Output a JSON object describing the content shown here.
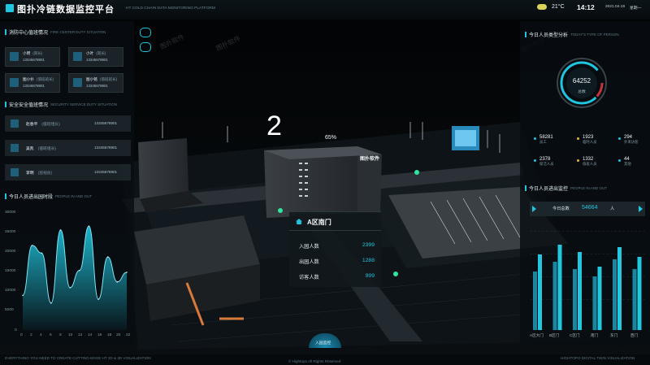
{
  "header": {
    "title": "图扑冷链数据监控平台",
    "subtitle": "HT COLD CHAIN DATA MONITORING PLATFORM",
    "temperature": "21°C",
    "time": "14:12",
    "date": "2021.04.19",
    "weekday": "星期一"
  },
  "left": {
    "duty": {
      "title": "消防中心值班情况",
      "title_en": "FIRE CENTER DUTY SITUATION",
      "people": [
        {
          "name": "小明",
          "role": "(岗长)",
          "phone": "13345678901"
        },
        {
          "name": "小叶",
          "role": "(岗长)",
          "phone": "13345678901"
        },
        {
          "name": "图小扑",
          "role": "(值班班长)",
          "phone": "13345678901"
        },
        {
          "name": "图小铭",
          "role": "(值班班长)",
          "phone": "13345678901"
        }
      ]
    },
    "security": {
      "title": "安全安全值班情况",
      "title_en": "SECURITY SERVICE DUTY SITUATION",
      "people": [
        {
          "name": "赵春平",
          "role": "(值班组长)",
          "phone": "13345678901"
        },
        {
          "name": "吴凯",
          "role": "(值班组长)",
          "phone": "13345678901"
        },
        {
          "name": "李明",
          "role": "(巡视员)",
          "phone": "13345678901"
        }
      ]
    },
    "flow": {
      "title": "今日人员进出园时段",
      "title_en": "PEOPLE IN AND OUT"
    }
  },
  "chart_data": [
    {
      "type": "area",
      "title": "今日人员进出园时段",
      "x": [
        0,
        2,
        4,
        6,
        8,
        10,
        12,
        14,
        16,
        18,
        20,
        22
      ],
      "series": [
        {
          "values": [
            9000,
            22000,
            20000,
            7000,
            26000,
            11000,
            15500,
            27000,
            8000,
            19000,
            12500,
            15000
          ]
        }
      ],
      "ylim": [
        0,
        30000
      ],
      "yticks": [
        "30000",
        "25000",
        "20000",
        "15000",
        "10000",
        "5000",
        "0"
      ],
      "xticks": [
        "0",
        "2",
        "4",
        "6",
        "8",
        "10",
        "12",
        "14",
        "16",
        "18",
        "20",
        "22"
      ],
      "color": "#1fc6e0"
    },
    {
      "type": "bar",
      "title": "今日人员进出监控",
      "categories": [
        "A区大门",
        "B区门",
        "C区门",
        "南门",
        "东门",
        "西门"
      ],
      "series": [
        {
          "values": [
            12000,
            14000,
            12500,
            11000,
            14500,
            12500
          ]
        },
        {
          "values": [
            15500,
            17500,
            16000,
            13000,
            17000,
            15000
          ]
        }
      ],
      "ylim": [
        0,
        22000
      ],
      "colors": [
        "#1a86a0",
        "#22c8e0"
      ]
    }
  ],
  "right": {
    "analysis": {
      "title": "今日人员类型分析",
      "title_en": "TODAY'S TYPE OF PERSON",
      "gauge_value": "64252",
      "gauge_label": "总数",
      "stats": [
        {
          "value": "58281",
          "label": "员工",
          "color": "#1fc6e0"
        },
        {
          "value": "1923",
          "label": "临时人员",
          "color": "#e8b53a"
        },
        {
          "value": "294",
          "label": "外来访客",
          "color": "#1fc6e0"
        },
        {
          "value": "2378",
          "label": "保洁人员",
          "color": "#1fc6e0"
        },
        {
          "value": "1332",
          "label": "值班人员",
          "color": "#e8b53a"
        },
        {
          "value": "44",
          "label": "其他",
          "color": "#1fc6e0"
        }
      ]
    },
    "monitor": {
      "title": "今日人员进出监控",
      "title_en": "PEOPLE IN AND OUT",
      "today_label": "今日总数",
      "today_value": "54664",
      "unit": "人"
    }
  },
  "scene": {
    "building_label": "2",
    "building_badge": "65%",
    "building_sign": "图扑软件",
    "popup": {
      "title": "A区南门",
      "rows": [
        {
          "label": "入园人数",
          "value": "2399"
        },
        {
          "label": "出园人数",
          "value": "1288"
        },
        {
          "label": "访客人数",
          "value": "999"
        }
      ]
    },
    "entry_button": "入园监控",
    "watermark": "图扑软件"
  },
  "footer": {
    "left": "EVERYTHING YOU NEED TO CREATE CUTTING-EDGE HT 2D & 3D VISUALIZATION",
    "center": "© Hightopo All Rights Reserved",
    "right": "HIGHTOPO DIGITAL TWIN VISUALIZATION"
  }
}
